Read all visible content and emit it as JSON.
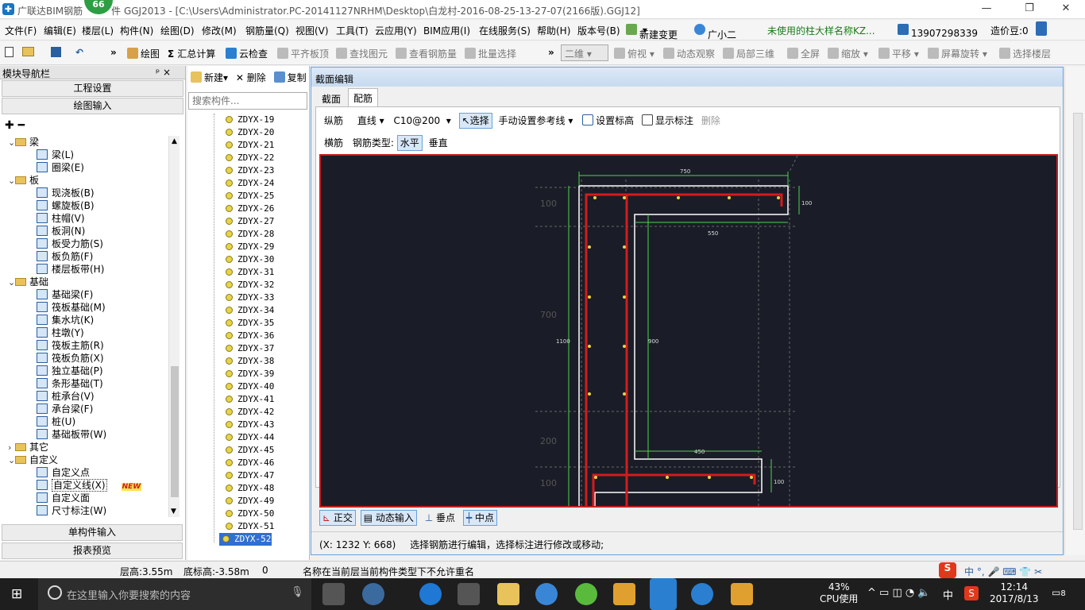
{
  "title_bar": {
    "app_name": "广联达BIM钢筋",
    "title_text": "件 GGJ2013 - [C:\\Users\\Administrator.PC-20141127NRHM\\Desktop\\白龙村-2016-08-25-13-27-07(2166版).GGJ12]",
    "badge": "66"
  },
  "menu": [
    "文件(F)",
    "编辑(E)",
    "楼层(L)",
    "构件(N)",
    "绘图(D)",
    "修改(M)",
    "钢筋量(Q)",
    "视图(V)",
    "工具(T)",
    "云应用(Y)",
    "BIM应用(I)",
    "在线服务(S)",
    "帮助(H)",
    "版本号(B)",
    "新建变更",
    "广小二",
    "未使用的柱大样名称KZ...",
    "13907298339",
    "造价豆:0"
  ],
  "toolbar": [
    "绘图",
    "汇总计算",
    "云检查",
    "平齐板顶",
    "查找图元",
    "查看钢筋量",
    "批量选择",
    "二维",
    "俯视",
    "动态观察",
    "局部三维",
    "全屏",
    "缩放",
    "平移",
    "屏幕旋转",
    "选择楼层"
  ],
  "nav": {
    "header": "模块导航栏",
    "pin": "ᵖ ×",
    "btn_project": "工程设置",
    "btn_draw": "绘图输入",
    "btn_single": "单构件输入",
    "btn_report": "报表预览",
    "tree": [
      {
        "label": "梁",
        "type": "folder",
        "indent": 0
      },
      {
        "label": "梁(L)",
        "type": "leaf",
        "indent": 1
      },
      {
        "label": "圈梁(E)",
        "type": "leaf",
        "indent": 1
      },
      {
        "label": "板",
        "type": "folder",
        "indent": 0
      },
      {
        "label": "现浇板(B)",
        "type": "leaf",
        "indent": 1
      },
      {
        "label": "螺旋板(B)",
        "type": "leaf",
        "indent": 1
      },
      {
        "label": "柱帽(V)",
        "type": "leaf",
        "indent": 1
      },
      {
        "label": "板洞(N)",
        "type": "leaf",
        "indent": 1
      },
      {
        "label": "板受力筋(S)",
        "type": "leaf",
        "indent": 1
      },
      {
        "label": "板负筋(F)",
        "type": "leaf",
        "indent": 1
      },
      {
        "label": "楼层板带(H)",
        "type": "leaf",
        "indent": 1
      },
      {
        "label": "基础",
        "type": "folder",
        "indent": 0
      },
      {
        "label": "基础梁(F)",
        "type": "leaf",
        "indent": 1
      },
      {
        "label": "筏板基础(M)",
        "type": "leaf",
        "indent": 1
      },
      {
        "label": "集水坑(K)",
        "type": "leaf",
        "indent": 1
      },
      {
        "label": "柱墩(Y)",
        "type": "leaf",
        "indent": 1
      },
      {
        "label": "筏板主筋(R)",
        "type": "leaf",
        "indent": 1
      },
      {
        "label": "筏板负筋(X)",
        "type": "leaf",
        "indent": 1
      },
      {
        "label": "独立基础(P)",
        "type": "leaf",
        "indent": 1
      },
      {
        "label": "条形基础(T)",
        "type": "leaf",
        "indent": 1
      },
      {
        "label": "桩承台(V)",
        "type": "leaf",
        "indent": 1
      },
      {
        "label": "承台梁(F)",
        "type": "leaf",
        "indent": 1
      },
      {
        "label": "桩(U)",
        "type": "leaf",
        "indent": 1
      },
      {
        "label": "基础板带(W)",
        "type": "leaf",
        "indent": 1
      },
      {
        "label": "其它",
        "type": "folder",
        "indent": 0
      },
      {
        "label": "自定义",
        "type": "folder",
        "indent": 0
      },
      {
        "label": "自定义点",
        "type": "leaf",
        "indent": 1
      },
      {
        "label": "自定义线(X)",
        "type": "leaf",
        "indent": 1,
        "selected": true
      },
      {
        "label": "自定义面",
        "type": "leaf",
        "indent": 1
      },
      {
        "label": "尺寸标注(W)",
        "type": "leaf",
        "indent": 1
      }
    ],
    "new_tag": "NEW"
  },
  "components": {
    "new_label": "新建",
    "delete_label": "删除",
    "copy_label": "复制",
    "search_placeholder": "搜索构件...",
    "items": [
      "ZDYX-19",
      "ZDYX-20",
      "ZDYX-21",
      "ZDYX-22",
      "ZDYX-23",
      "ZDYX-24",
      "ZDYX-25",
      "ZDYX-26",
      "ZDYX-27",
      "ZDYX-28",
      "ZDYX-29",
      "ZDYX-30",
      "ZDYX-31",
      "ZDYX-32",
      "ZDYX-33",
      "ZDYX-34",
      "ZDYX-35",
      "ZDYX-36",
      "ZDYX-37",
      "ZDYX-38",
      "ZDYX-39",
      "ZDYX-40",
      "ZDYX-41",
      "ZDYX-42",
      "ZDYX-43",
      "ZDYX-44",
      "ZDYX-45",
      "ZDYX-46",
      "ZDYX-47",
      "ZDYX-48",
      "ZDYX-49",
      "ZDYX-50",
      "ZDYX-51",
      "ZDYX-52"
    ],
    "selected": "ZDYX-52"
  },
  "dialog": {
    "title": "截面编辑",
    "tab_section": "截面",
    "tab_rebar": "配筋",
    "row1": {
      "longitudinal": "纵筋",
      "line": "直线",
      "spec": "C10@200",
      "select": "选择",
      "ref_line": "手动设置参考线",
      "set_height": "设置标高",
      "show_mark": "显示标注",
      "delete": "删除"
    },
    "row2": {
      "transverse": "横筋",
      "type_label": "钢筋类型:",
      "horizontal": "水平",
      "vertical": "垂直"
    },
    "dims": {
      "d750": "750",
      "d100a": "100",
      "d100b": "100",
      "d550": "550",
      "d700": "700",
      "d1100": "1100",
      "d900": "900",
      "d200": "200",
      "d450": "450",
      "d100c": "100",
      "d100d": "100"
    },
    "bottom": {
      "ortho": "正交",
      "dynamic": "动态输入",
      "perp": "垂点",
      "mid": "中点"
    },
    "coords": "(X: 1232 Y: 668)",
    "status": "选择钢筋进行编辑，选择标注进行修改或移动;"
  },
  "status_bar": {
    "floor_height": "层高:3.55m",
    "base_height": "底标高:-3.58m",
    "zero": "0",
    "message": "名称在当前层当前构件类型下不允许重名"
  },
  "taskbar": {
    "search_placeholder": "在这里输入你要搜索的内容",
    "cpu_pct": "43%",
    "cpu_label": "CPU使用",
    "ime": "中",
    "time": "12:14",
    "date": "2017/8/13",
    "notif": "8"
  }
}
